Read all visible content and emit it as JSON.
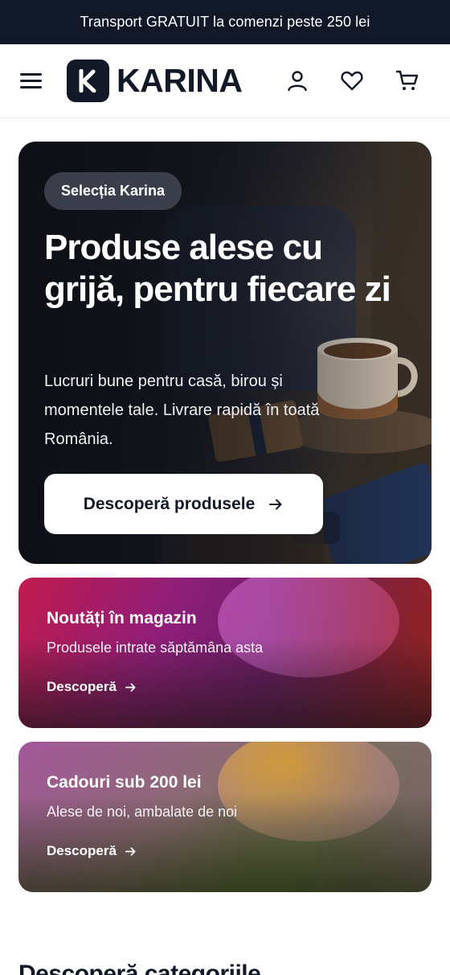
{
  "announcement": {
    "text": "Transport GRATUIT la comenzi peste 250 lei"
  },
  "header": {
    "logo_letter": "K",
    "logo_text": "KARINA",
    "icons": [
      "menu-icon",
      "user-icon",
      "heart-icon",
      "cart-icon"
    ]
  },
  "hero": {
    "badge": "Selecția Karina",
    "title": "Produse alese cu grijă, pentru fiecare zi",
    "subtitle": "Lucruri bune pentru casă, birou și momentele tale. Livrare rapidă în toată România.",
    "cta_label": "Descoperă produsele"
  },
  "promo_cards": [
    {
      "title": "Noutăți în magazin",
      "subtitle": "Produsele intrate săptămâna asta",
      "link_label": "Descoperă"
    },
    {
      "title": "Cadouri sub 200 lei",
      "subtitle": "Alese de noi, ambalate de noi",
      "link_label": "Descoperă"
    }
  ],
  "categories": {
    "title": "Descoperă categoriile"
  },
  "colors": {
    "dark": "#111827",
    "white": "#ffffff"
  }
}
